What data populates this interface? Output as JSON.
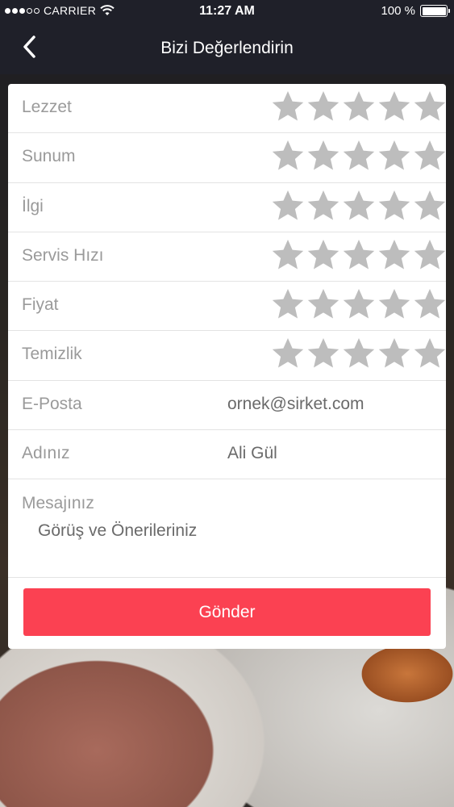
{
  "status_bar": {
    "carrier": "CARRIER",
    "time": "11:27 AM",
    "battery_percent_text": "100 %",
    "battery_level": 1.0,
    "signal_filled": 3,
    "signal_total": 5
  },
  "navbar": {
    "title": "Bizi Değerlendirin",
    "back_icon": "chevron-left-icon"
  },
  "ratings": [
    {
      "label": "Lezzet",
      "stars_filled": 0,
      "stars_total": 5
    },
    {
      "label": "Sunum",
      "stars_filled": 0,
      "stars_total": 5
    },
    {
      "label": "İlgi",
      "stars_filled": 0,
      "stars_total": 5
    },
    {
      "label": "Servis Hızı",
      "stars_filled": 0,
      "stars_total": 5
    },
    {
      "label": "Fiyat",
      "stars_filled": 0,
      "stars_total": 5
    },
    {
      "label": "Temizlik",
      "stars_filled": 0,
      "stars_total": 5
    }
  ],
  "form": {
    "email": {
      "label": "E-Posta",
      "placeholder": "ornek@sirket.com"
    },
    "name": {
      "label": "Adınız",
      "placeholder": "Ali Gül"
    },
    "message": {
      "label": "Mesajınız",
      "placeholder": "Görüş ve Önerileriniz"
    }
  },
  "submit": {
    "label": "Gönder"
  },
  "colors": {
    "navbar_bg": "#1f2029",
    "accent": "#fb4152",
    "star_empty": "#bdbdbd",
    "label_text": "#9a9a9a",
    "value_text": "#6a6a6a"
  }
}
